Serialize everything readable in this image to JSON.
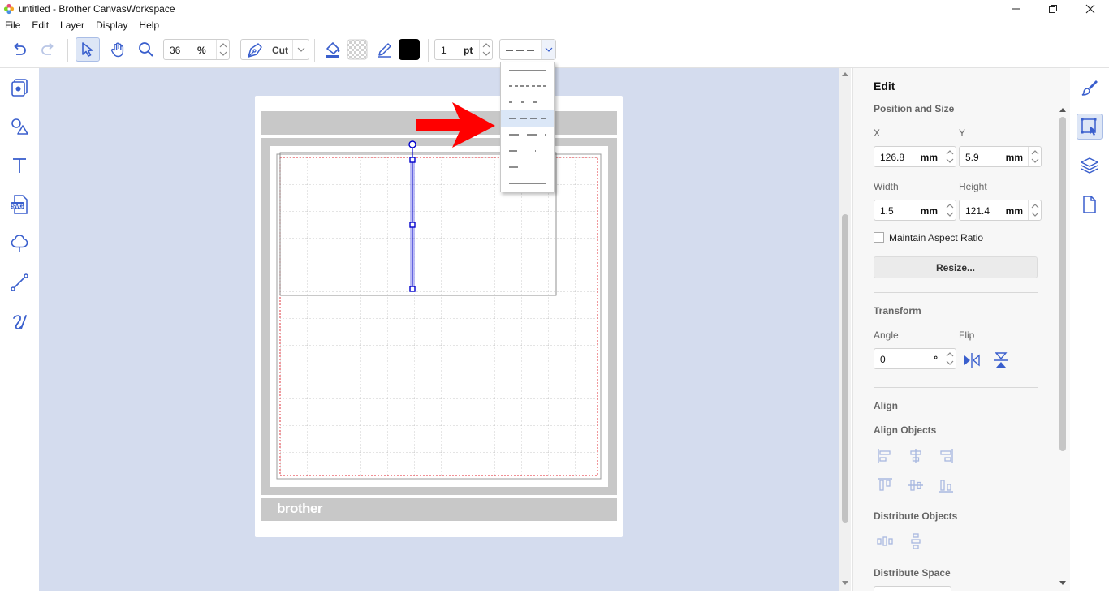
{
  "window": {
    "title": "untitled - Brother CanvasWorkspace"
  },
  "menu": [
    "File",
    "Edit",
    "Layer",
    "Display",
    "Help"
  ],
  "toolbar": {
    "zoom_value": "36",
    "zoom_unit": "%",
    "mode_label": "Cut",
    "line_width_value": "1",
    "line_width_unit": "pt",
    "stroke_color": "#000000"
  },
  "dash_options": [
    "solid-long",
    "dashed-fine",
    "dashed-sparse",
    "dashed-medium",
    "dashed-long",
    "dash-dot",
    "short-dash",
    "solid"
  ],
  "dash_selected_index": 3,
  "mat": {
    "brand": "brother"
  },
  "panel": {
    "title": "Edit",
    "position_size": {
      "heading": "Position and Size",
      "x_label": "X",
      "x_value": "126.8",
      "x_unit": "mm",
      "y_label": "Y",
      "y_value": "5.9",
      "y_unit": "mm",
      "width_label": "Width",
      "width_value": "1.5",
      "width_unit": "mm",
      "height_label": "Height",
      "height_value": "121.4",
      "height_unit": "mm",
      "aspect_label": "Maintain Aspect Ratio",
      "resize_label": "Resize..."
    },
    "transform": {
      "heading": "Transform",
      "angle_label": "Angle",
      "angle_value": "0",
      "angle_unit": "°",
      "flip_label": "Flip"
    },
    "align": {
      "heading": "Align",
      "align_objects_label": "Align Objects",
      "distribute_objects_label": "Distribute Objects",
      "distribute_space_label": "Distribute Space"
    }
  },
  "colors": {
    "accent": "#3a5fcd",
    "canvas_bg": "#d4dcee",
    "selection": "#0000cc",
    "arrow": "#ff0000"
  }
}
